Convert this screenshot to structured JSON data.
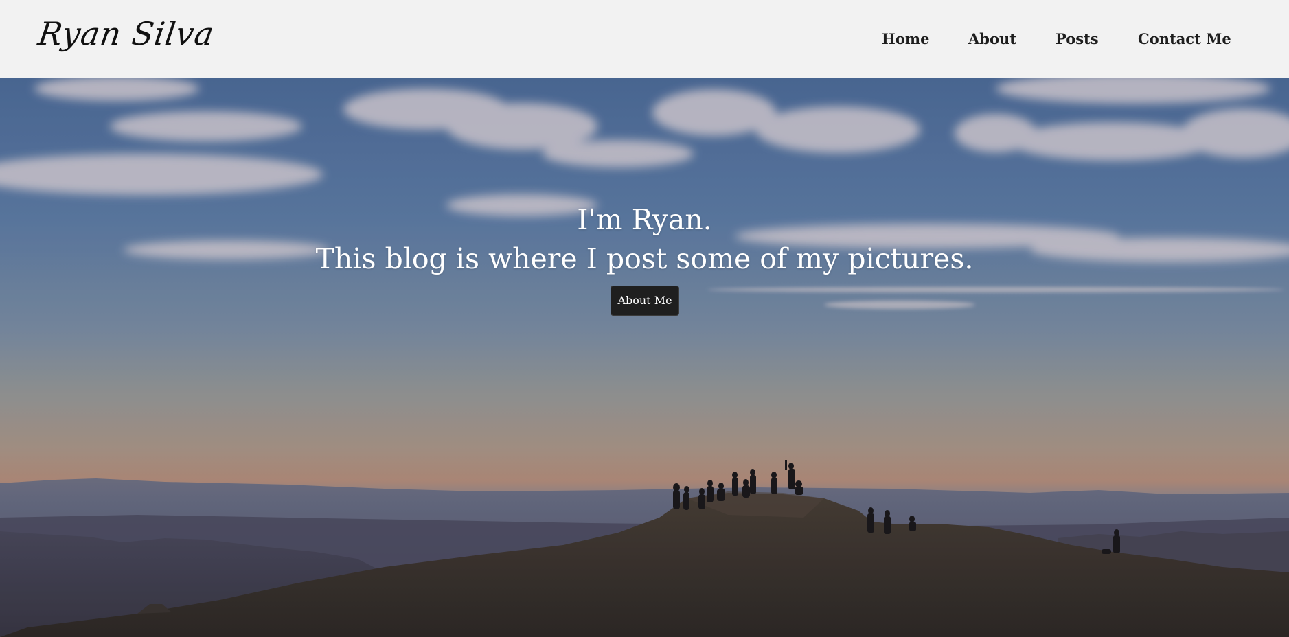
{
  "site": {
    "brand": "Ryan Silva"
  },
  "nav": {
    "items": [
      {
        "label": "Home"
      },
      {
        "label": "About"
      },
      {
        "label": "Posts"
      },
      {
        "label": "Contact Me"
      }
    ]
  },
  "hero": {
    "heading_line1": "I'm Ryan.",
    "heading_line2": "This blog is where I post some of my pictures.",
    "button_label": "About Me",
    "background_image": "mountain-summit-silhouette-photo"
  },
  "colors": {
    "navbar_bg": "#f2f2f2",
    "nav_text": "#1e1e1e",
    "button_bg": "#1f1f1f",
    "hero_text": "#ffffff"
  }
}
